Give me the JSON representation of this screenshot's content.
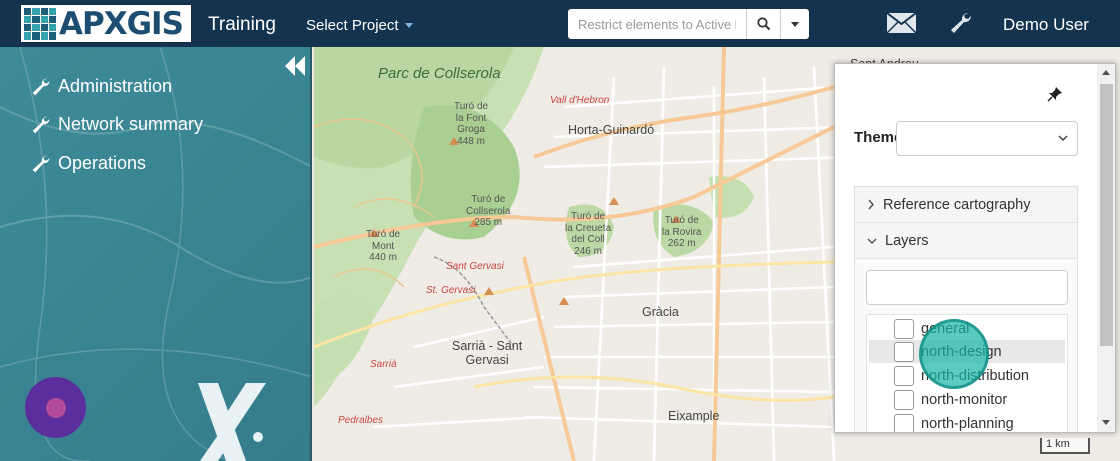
{
  "header": {
    "logo_text": "APXGIS",
    "app_title": "Training",
    "project_select_label": "Select Project",
    "search_placeholder": "Restrict elements to Active la",
    "user_name": "Demo User"
  },
  "sidebar": {
    "items": [
      {
        "label": "Administration",
        "icon": "wrench-icon"
      },
      {
        "label": "Network summary",
        "icon": "wrench-icon"
      },
      {
        "label": "Operations",
        "icon": "wrench-icon"
      }
    ]
  },
  "map": {
    "labels": [
      {
        "text": "Parc de\nCollserola",
        "kind": "park"
      },
      {
        "text": "Vall d'Hebron",
        "kind": "red"
      },
      {
        "text": "Horta-Guinardó",
        "kind": "big"
      },
      {
        "text": "Turó de\nla Font\nGroga\n448 m",
        "kind": "peak"
      },
      {
        "text": "Turó de\nCollserola\n285 m",
        "kind": "peak"
      },
      {
        "text": "Turó de\nla Creueta\ndel Coll\n246 m",
        "kind": "peak"
      },
      {
        "text": "Turó de\nla Rovira\n262 m",
        "kind": "peak"
      },
      {
        "text": "Turó de\nMont\n440 m",
        "kind": "peak"
      },
      {
        "text": "Sant Gervasi",
        "kind": "red"
      },
      {
        "text": "St. Gervasi",
        "kind": "red"
      },
      {
        "text": "Gràcia",
        "kind": "big"
      },
      {
        "text": "Sarrià - Sant\nGervasi",
        "kind": "big"
      },
      {
        "text": "Sarrià",
        "kind": "red"
      },
      {
        "text": "Pedralbes",
        "kind": "red"
      },
      {
        "text": "Eixample",
        "kind": "big"
      },
      {
        "text": "Sant Andreu",
        "kind": "big"
      }
    ],
    "scale_text": "1 km"
  },
  "layer_panel": {
    "theme_label": "Theme",
    "theme_value": "",
    "sections": [
      {
        "label": "Reference cartography",
        "expanded": false
      },
      {
        "label": "Layers",
        "expanded": true
      }
    ],
    "layer_filter_value": "",
    "layers": [
      {
        "label": "general",
        "checked": false
      },
      {
        "label": "north-design",
        "checked": false
      },
      {
        "label": "north-distribution",
        "checked": false
      },
      {
        "label": "north-monitor",
        "checked": false
      },
      {
        "label": "north-planning",
        "checked": false
      }
    ]
  },
  "colors": {
    "topbar": "#14334f",
    "sidebar": "#3a8593",
    "click_indicator": "#17b5a4"
  }
}
